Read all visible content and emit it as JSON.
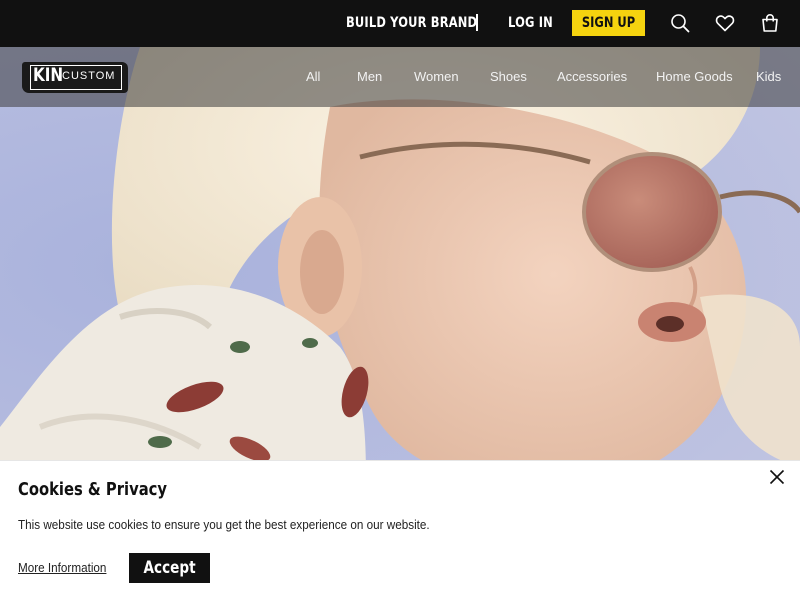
{
  "topbar": {
    "build_brand": "BUILD YOUR BRAND",
    "login": "LOG IN",
    "signup": "SIGN UP",
    "icons": [
      "search-icon",
      "heart-icon",
      "shopping-bag-icon"
    ]
  },
  "brand": {
    "logo_kin": "KIN",
    "logo_custom": "CUSTOM"
  },
  "nav": {
    "items": [
      {
        "label": "All"
      },
      {
        "label": "Men"
      },
      {
        "label": "Women"
      },
      {
        "label": "Shoes"
      },
      {
        "label": "Accessories"
      },
      {
        "label": "Home Goods"
      },
      {
        "label": "Kids"
      }
    ]
  },
  "cookie": {
    "title": "Cookies & Privacy",
    "text": "This website use cookies to ensure you get the best experience on our website.",
    "more": "More Information",
    "accept": "Accept"
  },
  "colors": {
    "topbar_bg": "#111111",
    "accent_yellow": "#f5d30f",
    "hero_bg": "#b7bde0"
  }
}
